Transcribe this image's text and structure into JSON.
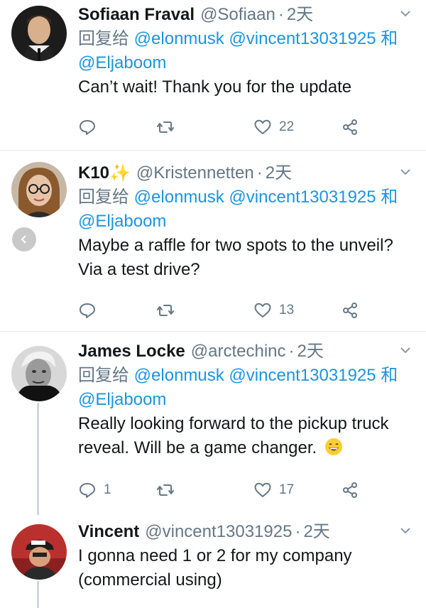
{
  "reply_prefix": "回复给",
  "reply_conjunction": "和",
  "colors": {
    "link": "#1b95e0",
    "muted": "#657786",
    "text": "#14171a",
    "divider": "#e1e8ed"
  },
  "tweets": [
    {
      "name": "Sofiaan Fraval",
      "name_emoji": "",
      "handle": "@Sofiaan",
      "time": "2天",
      "mention1": "@elonmusk",
      "mention2": "@vincent13031925",
      "mention3": "@Eljaboom",
      "text_lines": [
        "Can’t wait! Thank you for the update"
      ],
      "reply_count": "",
      "retweet_count": "",
      "like_count": "22"
    },
    {
      "name": "K10",
      "name_emoji": "✨",
      "handle": "@Kristennetten",
      "time": "2天",
      "mention1": "@elonmusk",
      "mention2": "@vincent13031925",
      "mention3": "@Eljaboom",
      "text_lines": [
        "Maybe a raffle for two spots to the unveil?",
        "Via a test drive?"
      ],
      "reply_count": "",
      "retweet_count": "",
      "like_count": "13"
    },
    {
      "name": "James Locke",
      "name_emoji": "",
      "handle": "@arctechinc",
      "time": "2天",
      "mention1": "@elonmusk",
      "mention2": "@vincent13031925",
      "mention3": "@Eljaboom",
      "text_lines": [
        "Really looking forward to the pickup truck",
        "reveal. Will be a game changer."
      ],
      "reply_count": "1",
      "retweet_count": "",
      "like_count": "17"
    },
    {
      "name": "Vincent",
      "name_emoji": "",
      "handle": "@vincent13031925",
      "time": "2天",
      "text_lines": [
        "I gonna need 1 or 2 for my company",
        "(commercial using)"
      ]
    }
  ]
}
